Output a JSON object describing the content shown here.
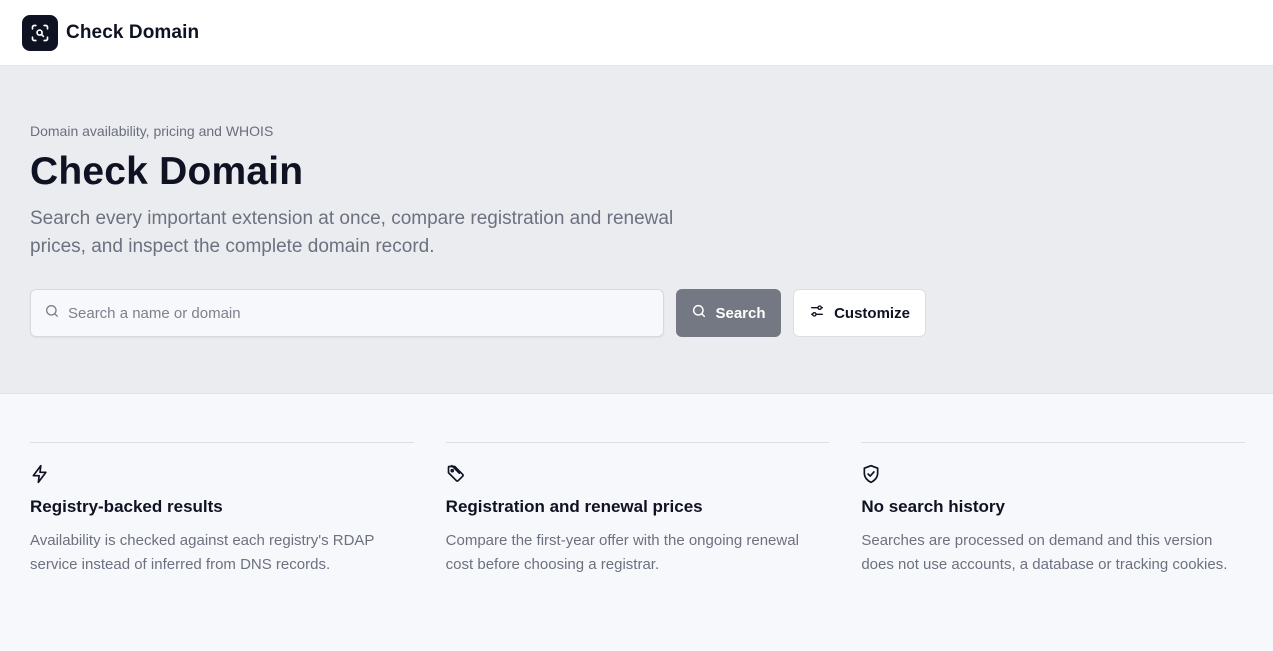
{
  "header": {
    "logo_icon": "scan-search-icon",
    "brand": "Check Domain"
  },
  "hero": {
    "eyebrow": "Domain availability, pricing and WHOIS",
    "title": "Check Domain",
    "subtitle": "Search every important extension at once, compare registration and renewal prices, and inspect the complete domain record.",
    "search": {
      "icon": "search-icon",
      "placeholder": "Search a name or domain",
      "value": ""
    },
    "search_button": {
      "label": "Search",
      "icon": "search-icon",
      "color": "#747883"
    },
    "customize_button": {
      "label": "Customize",
      "icon": "sliders-icon"
    }
  },
  "features": [
    {
      "icon": "lightning-icon",
      "title": "Registry-backed results",
      "description": "Availability is checked against each registry's RDAP service instead of inferred from DNS records."
    },
    {
      "icon": "tag-icon",
      "title": "Registration and renewal prices",
      "description": "Compare the first-year offer with the ongoing renewal cost before choosing a registrar."
    },
    {
      "icon": "shield-check-icon",
      "title": "No search history",
      "description": "Searches are processed on demand and this version does not use accounts, a database or tracking cookies."
    }
  ],
  "colors": {
    "brand_dark": "#0f1222",
    "hero_background": "#ebecf0",
    "page_background": "#f7f8fb",
    "muted_text": "#6c7180"
  }
}
